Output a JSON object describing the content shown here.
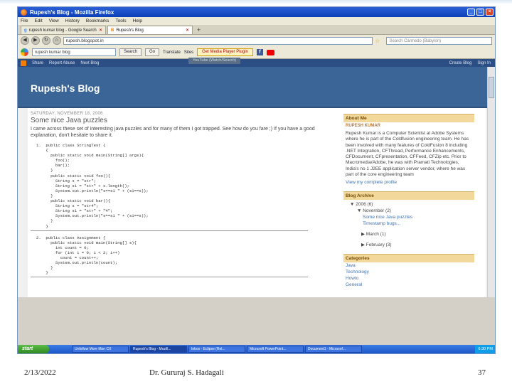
{
  "window": {
    "title": "Rupesh's Blog - Mozilla Firefox"
  },
  "menu": [
    "File",
    "Edit",
    "View",
    "History",
    "Bookmarks",
    "Tools",
    "Help"
  ],
  "tabs": [
    {
      "label": "rupesh kumar blog - Google Search"
    },
    {
      "label": "Rupesh's Blog"
    }
  ],
  "nav": {
    "url": "rupesh.blogspot.in",
    "search_placeholder": "Search Carmedo (Babylon)"
  },
  "gtoolbar": {
    "search_value": "rupesh kumar blog",
    "search_btn": "Search",
    "go": "Go",
    "translate": "Translate",
    "sites": "Sites",
    "player_btn": "Get Media Player Plugin"
  },
  "tooltip": "YouTube (Watch/Search)",
  "blogger": {
    "nav": [
      "Share",
      "Report Abuse",
      "Next Blog"
    ],
    "right": [
      "Create Blog",
      "Sign In"
    ]
  },
  "blog": {
    "title": "Rupesh's Blog"
  },
  "post": {
    "date": "SATURDAY, NOVEMBER 18, 2006",
    "title": "Some nice Java puzzles",
    "body": "I came across these set of interesting java puzzles and for many of them I got trapped. See how do you fare ;) If you have a good explanation, don't hesitate to share it.",
    "code1": "1.  public class StringTest {\n    {\n      public static void main(String[] args){\n        foo();\n        bar();\n      }\n      public static void foo(){\n        String s = \"str\";\n        String s1 = \"str\" + s.length();\n        System.out.println(\"s==s1 \" + (s1==s));\n      }\n      public static void bar(){\n        String s = \"str4\";\n        String s1 = \"str\" + \"4\";\n        System.out.println(\"s==s1 \" + (s1==s));\n      }\n    }",
    "code2": "2.  public class Assignment {\n      public static void main(String[] s){\n        int count = 0;\n        for (int i = 0; i < 3; i++)\n          count = count++;\n        System.out.println(count);\n      }\n    }"
  },
  "sidebar": {
    "about_head": "About Me",
    "about_name": "RUPESH KUMAR",
    "about_text": "Rupesh Kumar is a Computer Scientist at Adobe Systems where he is part of the Coldfusion engineering team. He has been involved with many features of ColdFusion 8 including .NET Integration, CFThread, Performance Enhancements, CFDocument, CFpresentation, CFFeed, CFZip etc. Prior to Macromedia/Adobe, he was with Pramati Technologies, India's no 1 J2EE application server vendor, where he was part of the core engineering team",
    "profile_link": "View my complete profile",
    "archive_head": "Blog Archive",
    "archive": {
      "year": "▼  2006 (6)",
      "month": "▼  November (2)",
      "posts": [
        "Some nice Java puzzles",
        "Timestamp bugs..."
      ],
      "m2": "▶  March (1)",
      "m3": "▶  February (3)"
    },
    "cat_head": "Categories",
    "cats": [
      "Java",
      "Technology",
      "Howto",
      "General"
    ]
  },
  "taskbar": {
    "start": "start",
    "items": [
      "Unfollow More Mon CX",
      "Rupesh's Blog - Mozill...",
      "Inbox - Eclipse (Rel...",
      "Microsoft PowerPoint...",
      "Document1 - Microsof..."
    ],
    "clock": "6:30 PM"
  },
  "footer": {
    "date": "2/13/2022",
    "author": "Dr. Gururaj S. Hadagali",
    "page": "37"
  }
}
